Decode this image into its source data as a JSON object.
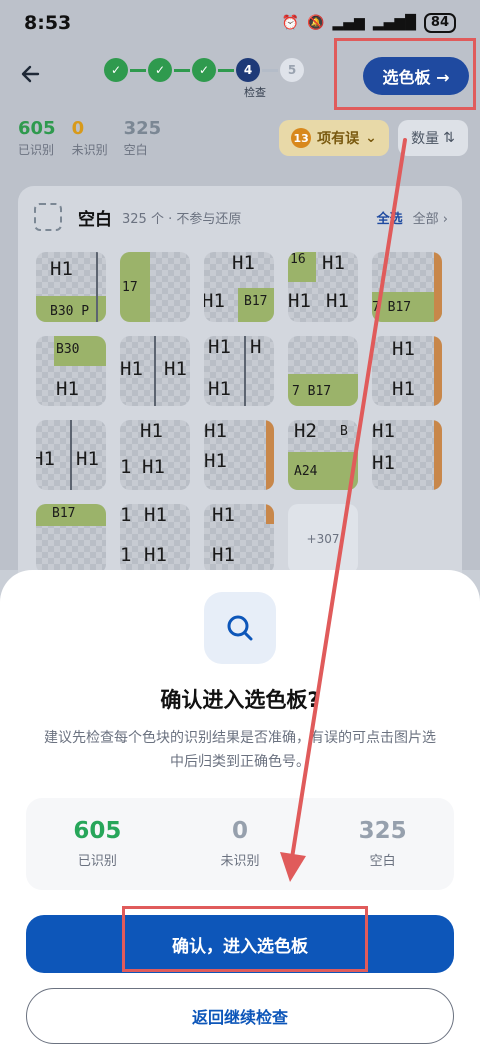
{
  "status_bar": {
    "time": "8:53",
    "battery": "84"
  },
  "header": {
    "steps": [
      "✓",
      "✓",
      "✓",
      "4",
      "5"
    ],
    "current_step_label": "检查",
    "palette_button": "选色板 →"
  },
  "stats": {
    "recognized": {
      "value": "605",
      "label": "已识别"
    },
    "unrecognized": {
      "value": "0",
      "label": "未识别"
    },
    "blank": {
      "value": "325",
      "label": "空白"
    }
  },
  "filters": {
    "error_count": "13",
    "error_label": "项有误",
    "sort_label": "数量"
  },
  "card": {
    "title": "空白",
    "subtitle": "325 个 · 不参与还原",
    "select_all": "全选",
    "all": "全部",
    "more_tile": "+307"
  },
  "sheet": {
    "title": "确认进入选色板?",
    "description": "建议先检查每个色块的识别结果是否准确，有误的可点击图片选中后归类到正确色号。",
    "stats": [
      {
        "value": "605",
        "label": "已识别"
      },
      {
        "value": "0",
        "label": "未识别"
      },
      {
        "value": "325",
        "label": "空白"
      }
    ],
    "confirm_button": "确认，进入选色板",
    "back_button": "返回继续检查"
  },
  "colors": {
    "accent": "#0d56b9",
    "success": "#27a65a",
    "warning": "#d8881c",
    "annotation": "#e05b5b"
  }
}
